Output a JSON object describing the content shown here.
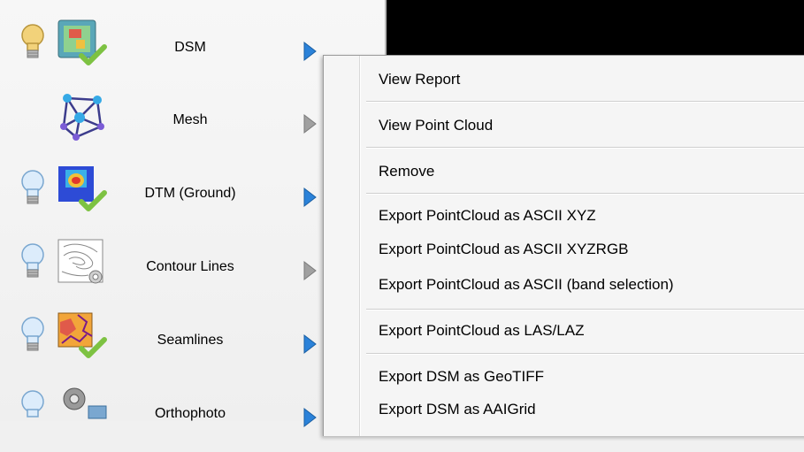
{
  "rows": [
    {
      "label": "DSM",
      "bulb": "lit",
      "thumb": "dsm-raster-icon",
      "status": "check"
    },
    {
      "label": "Mesh",
      "bulb": "none",
      "thumb": "mesh-network-icon",
      "status": "none"
    },
    {
      "label": "DTM (Ground)",
      "bulb": "off",
      "thumb": "dtm-heatmap-icon",
      "status": "check"
    },
    {
      "label": "Contour Lines",
      "bulb": "off",
      "thumb": "contour-map-icon",
      "status": "gear"
    },
    {
      "label": "Seamlines",
      "bulb": "off",
      "thumb": "seamlines-icon",
      "status": "check"
    },
    {
      "label": "Orthophoto",
      "bulb": "off",
      "thumb": "gear-icon",
      "status": "none"
    }
  ],
  "menu": {
    "items": [
      "View Report",
      "View Point Cloud",
      "Remove",
      "Export PointCloud as ASCII XYZ",
      "Export PointCloud as ASCII XYZRGB",
      "Export PointCloud as ASCII (band selection)",
      "Export PointCloud as LAS/LAZ",
      "Export DSM as GeoTIFF",
      "Export DSM as AAIGrid"
    ]
  },
  "colors": {
    "arrow_enabled": "#2b82d9",
    "arrow_disabled": "#8a8a8a",
    "check": "#7dc242",
    "bulb_lit": "#f2d27a",
    "bulb_off": "#bcd9f5"
  }
}
